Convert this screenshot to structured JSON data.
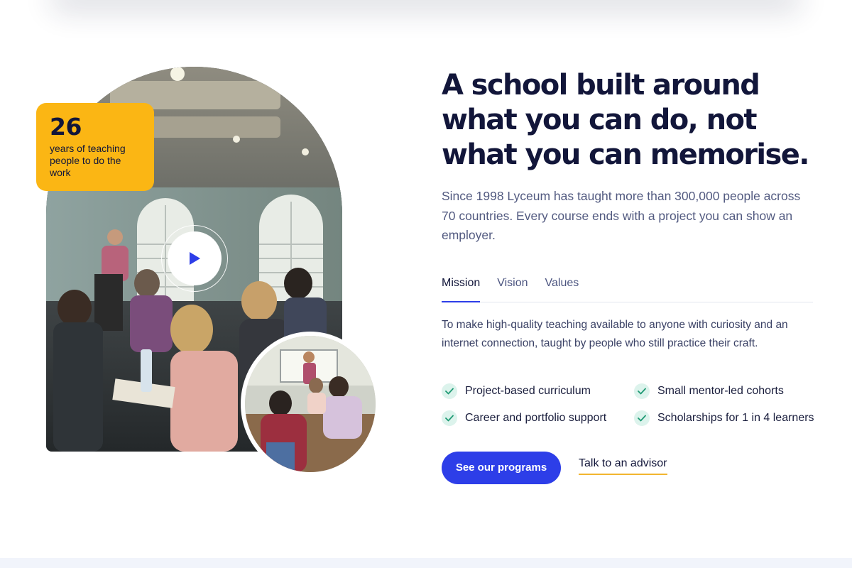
{
  "hero": {
    "stat": {
      "number": "26",
      "label": "years of teaching people to do the work"
    },
    "headline": [
      "A school built around",
      "what you can do, not",
      "what you can memorise."
    ],
    "intro": "Since 1998 Lyceum has taught more than 300,000 people across 70 countries. Every course ends with a project you can show an employer."
  },
  "tabs": [
    {
      "label": "Mission",
      "active": true
    },
    {
      "label": "Vision",
      "active": false
    },
    {
      "label": "Values",
      "active": false
    }
  ],
  "panel": {
    "text": "To make high-quality teaching available to anyone with curiosity and an internet connection, taught by people who still practice their craft."
  },
  "features": [
    {
      "label": "Project-based curriculum"
    },
    {
      "label": "Small mentor-led cohorts"
    },
    {
      "label": "Career and portfolio support"
    },
    {
      "label": "Scholarships for 1 in 4 learners"
    }
  ],
  "actions": {
    "primary_label": "See our programs",
    "secondary_label": "Talk to an advisor"
  },
  "icons": {
    "play": "play-icon",
    "check": "check-icon"
  },
  "colors": {
    "brand": "#2d3ee8",
    "heading": "#12163a",
    "badge": "#fbb614",
    "check_bg": "#dcf3ec",
    "check_mark": "#1f9a74",
    "link_underline": "#f2b630"
  }
}
